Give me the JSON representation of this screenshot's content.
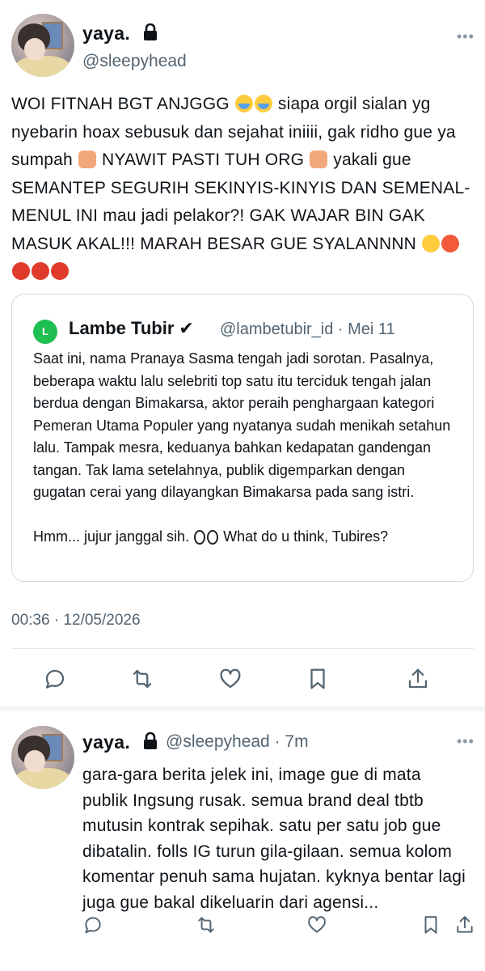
{
  "main_tweet": {
    "display_name": "yaya.",
    "handle": "@sleepyhead",
    "more_label": "•••",
    "text_segments": {
      "s1": "WOI FITNAH BGT ANJGGG ",
      "s2": " siapa orgil sialan yg nyebarin hoax sebusuk dan sejahat iniiii, gak ridho gue ya sumpah ",
      "s3": " NYAWIT PASTI TUH ORG ",
      "s4": " yakali gue SEMANTEP SEGURIH SEKINYIS-KINYIS DAN SEMENAL-MENUL INI mau jadi pelakor?! GAK WAJAR BIN GAK MASUK AKAL!!! MARAH BESAR GUE SYALANNNN "
    },
    "timestamp": "00:36 · 12/05/2026"
  },
  "quoted_tweet": {
    "avatar_letter": "L",
    "display_name": "Lambe Tubir",
    "verified_mark": "✔",
    "handle_date": "@lambetubir_id · Mei 11",
    "paragraph1": "Saat ini, nama Pranaya Sasma tengah jadi sorotan. Pasalnya, beberapa waktu lalu selebriti top satu itu terciduk tengah jalan berdua dengan Bimakarsa, aktor peraih penghargaan kategori Pemeran Utama Populer yang nyatanya sudah menikah setahun lalu. Tampak mesra, keduanya bahkan kedapatan gandengan tangan. Tak lama setelahnya, publik digemparkan dengan gugatan cerai yang dilayangkan Bimakarsa pada sang istri.",
    "paragraph2_a": "Hmm... jujur janggal sih. ",
    "paragraph2_b": " What do u think, Tubires?"
  },
  "reply_tweet": {
    "display_name": "yaya.",
    "handle_time": "@sleepyhead · 7m",
    "more_label": "•••",
    "text": "gara-gara berita jelek ini, image gue di mata publik Ingsung rusak. semua brand deal tbtb mutusin kontrak sepihak. satu per satu job gue dibatalin. folls IG turun gila-gilaan. semua kolom komentar penuh sama hujatan. kyknya bentar lagi juga gue bakal dikeluarin dari agensi..."
  },
  "icons": {
    "lock": "lock-icon",
    "reply": "reply-icon",
    "retweet": "retweet-icon",
    "like": "like-icon",
    "bookmark": "bookmark-icon",
    "share": "share-icon"
  },
  "colors": {
    "text": "#0f1419",
    "secondary": "#536471",
    "border": "#cfd9de",
    "quote_avatar": "#1fbf52"
  }
}
